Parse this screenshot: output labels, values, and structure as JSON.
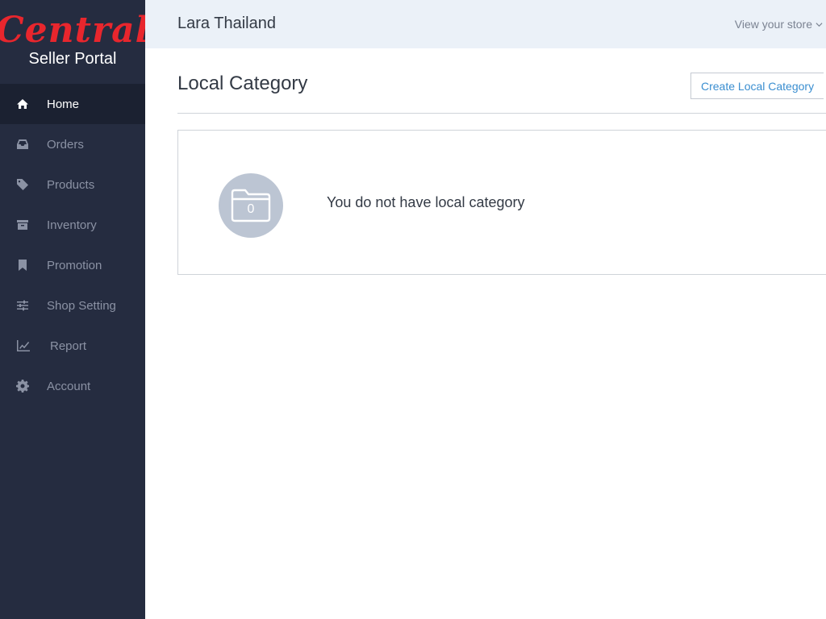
{
  "brand": {
    "logo_text": "Central",
    "subtitle": "Seller Portal"
  },
  "sidebar": {
    "items": [
      {
        "label": "Home",
        "icon": "home-icon",
        "active": true
      },
      {
        "label": "Orders",
        "icon": "inbox-icon",
        "active": false
      },
      {
        "label": "Products",
        "icon": "tag-icon",
        "active": false
      },
      {
        "label": "Inventory",
        "icon": "archive-icon",
        "active": false
      },
      {
        "label": "Promotion",
        "icon": "bookmark-icon",
        "active": false
      },
      {
        "label": "Shop Setting",
        "icon": "sliders-icon",
        "active": false
      },
      {
        "label": "Report",
        "icon": "line-chart-icon",
        "active": false
      },
      {
        "label": "Account",
        "icon": "gear-icon",
        "active": false
      }
    ]
  },
  "header": {
    "shop_name": "Lara Thailand",
    "store_link": "View your store"
  },
  "main": {
    "title": "Local Category",
    "create_button": "Create Local Category",
    "empty": {
      "count": "0",
      "message": "You do not have local category"
    }
  },
  "colors": {
    "sidebar_bg": "#252c40",
    "accent_red": "#e8262d",
    "link_blue": "#3a8ed0",
    "topbar_bg": "#ebf1f8"
  }
}
